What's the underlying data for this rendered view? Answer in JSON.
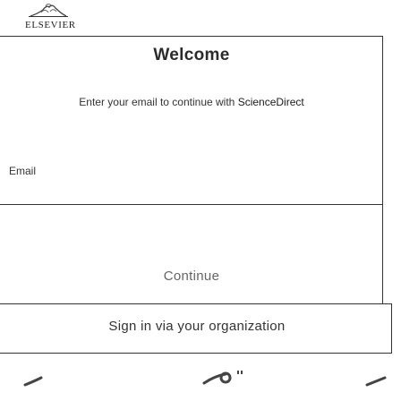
{
  "brand": {
    "logo_text": "ELSEVIER"
  },
  "login": {
    "title": "Welcome",
    "subtitle_prefix": "Enter your email to continue with ",
    "subtitle_product": "ScienceDirect",
    "email_label": "Email",
    "continue_label": "Continue",
    "sso_label": "Sign in via your organization"
  },
  "colors": {
    "border": "#333333",
    "text": "#222222",
    "muted_text": "#666666",
    "background": "#ffffff"
  }
}
